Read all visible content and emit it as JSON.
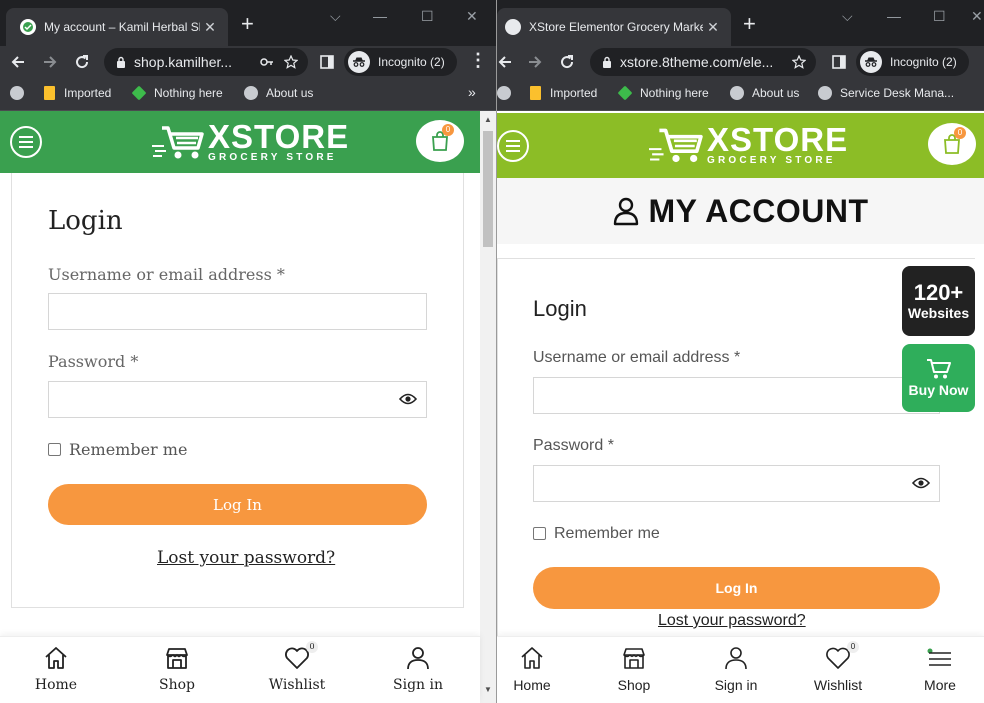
{
  "left": {
    "tab_title": "My account – Kamil Herbal Sh",
    "new_tab": "+",
    "url": "shop.kamilher...",
    "incognito_label": "Incognito (2)",
    "bookmarks": [
      {
        "label": "",
        "icon": "globe-icon"
      },
      {
        "label": "Imported",
        "icon": "folder-icon"
      },
      {
        "label": "Nothing here",
        "icon": "tag-icon"
      },
      {
        "label": "About us",
        "icon": "globe-icon"
      }
    ],
    "bookmarks_more": "»",
    "brand": "XSTORE",
    "brand_sub": "GROCERY STORE",
    "cart_count": "0",
    "header_color": "#3aa04f",
    "login_heading": "Login",
    "username_label": "Username or email address *",
    "username_value": "",
    "password_label": "Password *",
    "password_value": "",
    "remember_label": "Remember me",
    "login_button": "Log In",
    "lost_password": "Lost your password?",
    "bottom_nav": [
      {
        "label": "Home",
        "icon": "home-icon"
      },
      {
        "label": "Shop",
        "icon": "shop-icon"
      },
      {
        "label": "Wishlist",
        "icon": "heart-icon",
        "count": "0"
      },
      {
        "label": "Sign in",
        "icon": "user-icon"
      }
    ]
  },
  "right": {
    "tab_title": "XStore Elementor Grocery Marke",
    "new_tab": "+",
    "url": "xstore.8theme.com/ele...",
    "incognito_label": "Incognito (2)",
    "bookmarks": [
      {
        "label": "",
        "icon": "globe-icon"
      },
      {
        "label": "Imported",
        "icon": "folder-icon"
      },
      {
        "label": "Nothing here",
        "icon": "tag-icon"
      },
      {
        "label": "About us",
        "icon": "globe-icon"
      },
      {
        "label": "Service Desk Mana...",
        "icon": "globe-icon"
      }
    ],
    "brand": "XSTORE",
    "brand_sub": "GROCERY STORE",
    "cart_count": "0",
    "header_color": "#8cbd26",
    "page_title": "MY ACCOUNT",
    "login_heading": "Login",
    "username_label": "Username or email address *",
    "username_value": "",
    "password_label": "Password *",
    "password_value": "",
    "remember_label": "Remember me",
    "login_button": "Log In",
    "lost_password": "Lost your password?",
    "promo_websites_big": "120+",
    "promo_websites_small": "Websites",
    "promo_buy_now": "Buy Now",
    "bottom_nav": [
      {
        "label": "Home",
        "icon": "home-icon"
      },
      {
        "label": "Shop",
        "icon": "shop-icon"
      },
      {
        "label": "Sign in",
        "icon": "user-icon"
      },
      {
        "label": "Wishlist",
        "icon": "heart-icon",
        "count": "0"
      },
      {
        "label": "More",
        "icon": "menu-icon"
      }
    ]
  },
  "colors": {
    "accent_orange": "#f7973f",
    "chrome_dark": "#202124",
    "chrome_mid": "#35363a",
    "promo_dark": "#222222",
    "promo_green": "#2fae5b"
  }
}
